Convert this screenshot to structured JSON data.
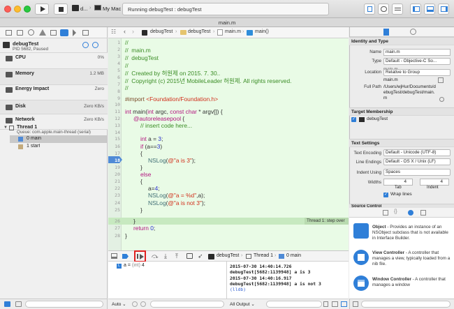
{
  "toolbar": {
    "scheme": "d...",
    "destination": "My Mac",
    "status": "Running debugTest : debugTest"
  },
  "tab": {
    "title": "main.m"
  },
  "navigator": {
    "process": {
      "name": "debugTest",
      "detail": "PID 5682, Paused"
    },
    "gauges": [
      {
        "label": "CPU",
        "value": "0%"
      },
      {
        "label": "Memory",
        "value": "1.2 MB"
      },
      {
        "label": "Energy Impact",
        "value": "Zero"
      },
      {
        "label": "Disk",
        "value": "Zero KB/s"
      },
      {
        "label": "Network",
        "value": "Zero KB/s"
      }
    ],
    "thread": {
      "name": "Thread 1",
      "queue": "Queue: com.apple.main-thread (serial)"
    },
    "frames": [
      {
        "label": "0 main"
      },
      {
        "label": "1 start"
      }
    ]
  },
  "jumpbar": {
    "crumbs": [
      "debugTest",
      "debugTest",
      "main.m",
      "main()"
    ]
  },
  "editor": {
    "line_numbers": [
      "1",
      "2",
      "3",
      "4",
      "5",
      "6",
      "7",
      "8",
      "9",
      "10",
      "11",
      "12",
      "13",
      "14",
      "15",
      "16",
      "17",
      "18",
      "19",
      "20",
      "21",
      "22",
      "23",
      "24",
      "25",
      "26",
      "27",
      "28"
    ],
    "current_line": "18",
    "lines": {
      "l1": "//",
      "l2": "//  main.m",
      "l3": "//  debugTest",
      "l4": "//",
      "l5": "//  Created by 허원제 on 2015. 7. 30..",
      "l6": "//  Copyright (c) 2015년 MobileLeader 허원제. All rights reserved.",
      "l7": "//",
      "l9a": "#import ",
      "l9b": "<Foundation/Foundation.h>",
      "l11a": "int",
      "l11b": " main(",
      "l11c": "int",
      "l11d": " argc, ",
      "l11e": "const char",
      "l11f": " * argv[]) {",
      "l12a": "@autoreleasepool",
      "l12b": " {",
      "l13": "// insert code here...",
      "l15a": "int",
      "l15b": " a = ",
      "l15c": "3",
      "l15d": ";",
      "l16a": "if",
      "l16b": " (a==",
      "l16c": "3",
      "l16d": ")",
      "l17": "{",
      "l18a": "NSLog",
      "l18b": "(",
      "l18c": "@\"a is 3\"",
      "l18d": ");",
      "l19": "}",
      "l20": "else",
      "l21": "{",
      "l22a": "a=",
      "l22b": "4",
      "l22c": ";",
      "l23a": "NSLog",
      "l23b": "(",
      "l23c": "@\"a = %d\"",
      "l23d": ",a);",
      "l24a": "NSLog",
      "l24b": "(",
      "l24c": "@\"a is not 3\"",
      "l24d": ");",
      "l25": "}",
      "l26": "}",
      "l27a": "return",
      "l27b": " ",
      "l27c": "0",
      "l27d": ";",
      "l28": "}"
    },
    "thread_badge": "Thread 1: step over"
  },
  "debugbar": {
    "crumbs": [
      "debugTest",
      "Thread 1",
      "0 main"
    ]
  },
  "variables": {
    "name": "a",
    "type": "(int)",
    "value": "4"
  },
  "console": {
    "lines": [
      "2015-07-30 14:40:14.726",
      "debugTest[5682:1139948] a is 3",
      "2015-07-30 14:40:16.917",
      "debugTest[5682:1139948] a is not 3",
      "(lldb)"
    ],
    "scope": "All Output",
    "auto": "Auto"
  },
  "inspector": {
    "identity": {
      "header": "Identity and Type",
      "name_label": "Name",
      "name_value": "main.m",
      "type_label": "Type",
      "type_value": "Default - Objective-C So...",
      "file": "main.m",
      "location_label": "Location",
      "location_value": "Relative to Group",
      "path": "main.m",
      "full_path_label": "Full Path",
      "full_path": "/Users/wjHur/Documents/debugTest/debugTest/main.m"
    },
    "membership": {
      "header": "Target Membership",
      "target": "debugTest"
    },
    "text": {
      "header": "Text Settings",
      "encoding_label": "Text Encoding",
      "encoding_value": "Default - Unicode (UTF-8)",
      "endings_label": "Line Endings",
      "endings_value": "Default - OS X / Unix (LF)",
      "indent_label": "Indent Using",
      "indent_value": "Spaces",
      "widths_label": "Widths",
      "tab_value": "4",
      "indent_width_value": "4",
      "tab_label": "Tab",
      "indent_label2": "Indent",
      "wrap_label": "Wrap lines"
    },
    "source_control": "Source Control",
    "library": [
      {
        "title": "Object",
        "desc": " - Provides an instance of an NSObject subclass that is not available in Interface Builder."
      },
      {
        "title": "View Controller",
        "desc": " - A controller that manages a view, typically loaded from a nib file."
      },
      {
        "title": "Window Controller",
        "desc": " - A controller that manages a window"
      }
    ]
  },
  "colors": {
    "editor_bg": "#e9fbe6",
    "current_line": "#c7e9c0",
    "accent": "#2f7fd8",
    "highlight_red": "#e02020"
  }
}
